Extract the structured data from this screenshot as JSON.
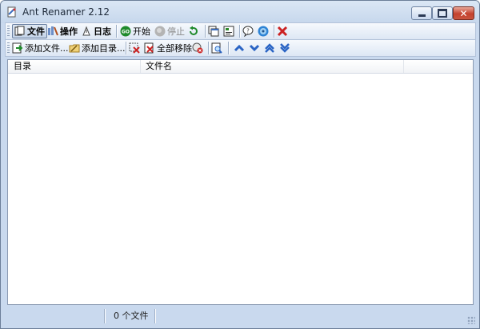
{
  "window": {
    "title": "Ant Renamer 2.12"
  },
  "toolbar_main": {
    "file": "文件",
    "actions": "操作",
    "log": "日志",
    "start": "开始",
    "stop": "停止"
  },
  "toolbar_files": {
    "add_files": "添加文件...",
    "add_folders": "添加目录...",
    "remove_all": "全部移除"
  },
  "file_list": {
    "columns": [
      "目录",
      "文件名",
      ""
    ]
  },
  "statusbar": {
    "count": "0 个文件"
  },
  "colors": {
    "window_bg": "#c9d9ee",
    "close_button": "#c4412d",
    "start_green": "#1f8a2b",
    "remove_red": "#cc2222",
    "arrow_blue": "#2a64c4"
  }
}
